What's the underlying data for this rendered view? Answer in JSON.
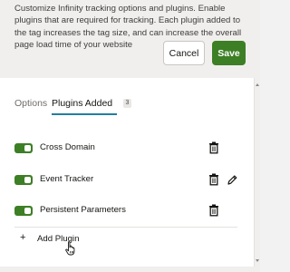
{
  "description": "Customize Infinity tracking options and plugins. Enable plugins that are required for tracking. Each plugin added to the tag increases the tag size, and can increase the overall page load time of your website",
  "buttons": {
    "cancel": "Cancel",
    "save": "Save"
  },
  "tabs": [
    {
      "label": "Options",
      "selected": false
    },
    {
      "label": "Plugins Added",
      "selected": true,
      "badge": "3"
    }
  ],
  "plugins": [
    {
      "name": "Cross Domain",
      "enabled": true
    },
    {
      "name": "Event Tracker",
      "enabled": true
    },
    {
      "name": "Persistent Parameters",
      "enabled": true
    }
  ],
  "add_plugin": {
    "icon": "+",
    "label": "Add Plugin"
  },
  "colors": {
    "accent_green": "#3d7f25",
    "tab_underline": "#227e9e"
  }
}
